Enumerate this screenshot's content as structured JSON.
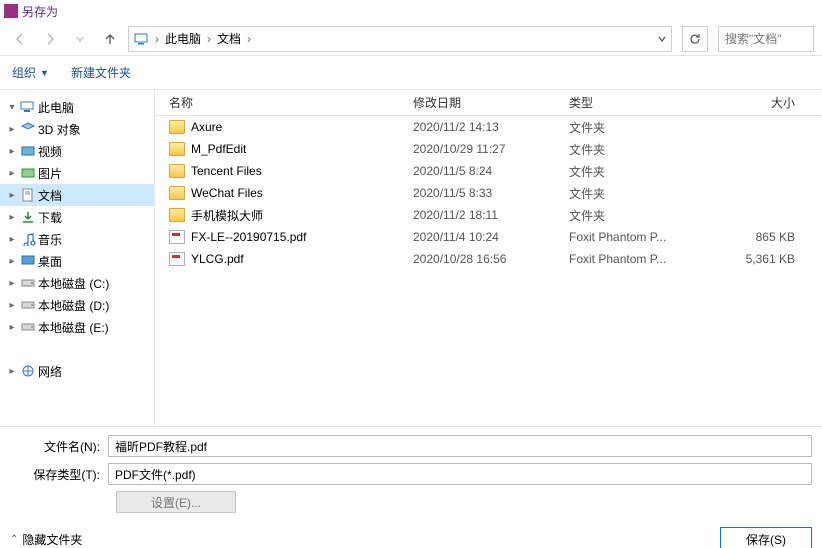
{
  "window": {
    "title": "另存为"
  },
  "breadcrumb": {
    "seg1": "此电脑",
    "seg2": "文档"
  },
  "search": {
    "placeholder": "搜索\"文档\""
  },
  "toolbar": {
    "organize": "组织",
    "newfolder": "新建文件夹"
  },
  "tree": {
    "items": [
      {
        "label": "此电脑",
        "exp": "▾",
        "icon": "pc"
      },
      {
        "label": "3D 对象",
        "exp": "▸",
        "icon": "3d"
      },
      {
        "label": "视频",
        "exp": "▸",
        "icon": "video"
      },
      {
        "label": "图片",
        "exp": "▸",
        "icon": "pic"
      },
      {
        "label": "文档",
        "exp": "▸",
        "icon": "doc",
        "sel": true
      },
      {
        "label": "下载",
        "exp": "▸",
        "icon": "dl"
      },
      {
        "label": "音乐",
        "exp": "▸",
        "icon": "music"
      },
      {
        "label": "桌面",
        "exp": "▸",
        "icon": "desk"
      },
      {
        "label": "本地磁盘 (C:)",
        "exp": "▸",
        "icon": "disk"
      },
      {
        "label": "本地磁盘 (D:)",
        "exp": "▸",
        "icon": "disk"
      },
      {
        "label": "本地磁盘 (E:)",
        "exp": "▸",
        "icon": "disk"
      },
      {
        "label": "",
        "exp": "",
        "icon": ""
      },
      {
        "label": "网络",
        "exp": "▸",
        "icon": "net"
      }
    ]
  },
  "columns": {
    "name": "名称",
    "date": "修改日期",
    "type": "类型",
    "size": "大小"
  },
  "rows": [
    {
      "name": "Axure",
      "date": "2020/11/2 14:13",
      "type": "文件夹",
      "size": "",
      "kind": "folder"
    },
    {
      "name": "M_PdfEdit",
      "date": "2020/10/29 11:27",
      "type": "文件夹",
      "size": "",
      "kind": "folder"
    },
    {
      "name": "Tencent Files",
      "date": "2020/11/5 8:24",
      "type": "文件夹",
      "size": "",
      "kind": "folder"
    },
    {
      "name": "WeChat Files",
      "date": "2020/11/5 8:33",
      "type": "文件夹",
      "size": "",
      "kind": "folder"
    },
    {
      "name": "手机模拟大师",
      "date": "2020/11/2 18:11",
      "type": "文件夹",
      "size": "",
      "kind": "folder"
    },
    {
      "name": "FX-LE--20190715.pdf",
      "date": "2020/11/4 10:24",
      "type": "Foxit Phantom P...",
      "size": "865 KB",
      "kind": "pdf"
    },
    {
      "name": "YLCG.pdf",
      "date": "2020/10/28 16:56",
      "type": "Foxit Phantom P...",
      "size": "5,361 KB",
      "kind": "pdf"
    }
  ],
  "fields": {
    "filename_label": "文件名(N):",
    "filename_value": "福昕PDF教程.pdf",
    "filetype_label": "保存类型(T):",
    "filetype_value": "PDF文件(*.pdf)",
    "settings": "设置(E)..."
  },
  "footer": {
    "hide": "隐藏文件夹",
    "save": "保存(S)"
  }
}
